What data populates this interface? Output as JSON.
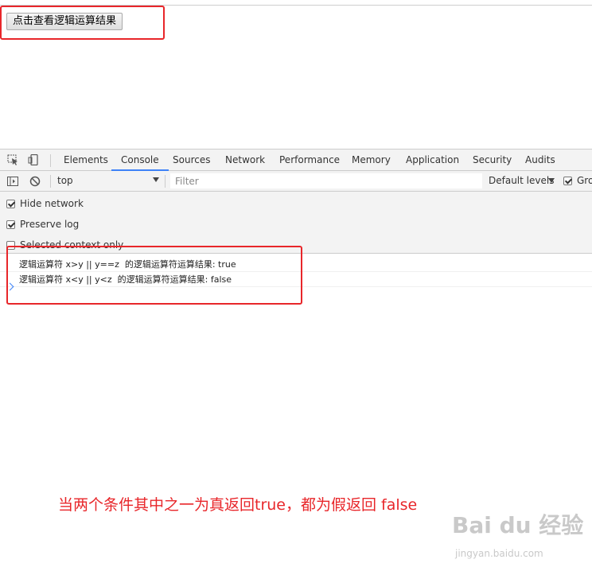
{
  "page": {
    "button_label": "点击查看逻辑运算结果",
    "caption": "当两个条件其中之一为真返回true，都为假返回 false"
  },
  "devtools": {
    "tabs": [
      {
        "label": "Elements",
        "active": false
      },
      {
        "label": "Console",
        "active": true
      },
      {
        "label": "Sources",
        "active": false
      },
      {
        "label": "Network",
        "active": false
      },
      {
        "label": "Performance",
        "active": false
      },
      {
        "label": "Memory",
        "active": false
      },
      {
        "label": "Application",
        "active": false
      },
      {
        "label": "Security",
        "active": false
      },
      {
        "label": "Audits",
        "active": false
      }
    ],
    "toolbar": {
      "context": "top",
      "filter_placeholder": "Filter",
      "levels": "Default levels",
      "group_label": "Gro"
    },
    "settings": [
      {
        "label": "Hide network",
        "checked": true
      },
      {
        "label": "Preserve log",
        "checked": true
      },
      {
        "label": "Selected context only",
        "checked": false
      }
    ],
    "console_messages": [
      "逻辑运算符 x>y || y==z  的逻辑运算符运算结果: true",
      "逻辑运算符 x<y || y<z  的逻辑运算符运算结果: false"
    ]
  },
  "watermark": {
    "brand": "Bai du 经验",
    "url": "jingyan.baidu.com"
  },
  "colors": {
    "annotation_red": "#e8262a",
    "active_tab_underline": "#3e82f7",
    "devtools_bg": "#f3f3f3"
  },
  "icons": {
    "inspect": "inspect-element-icon",
    "device": "device-toolbar-icon",
    "sidebar": "console-sidebar-icon",
    "clear": "clear-console-icon"
  }
}
